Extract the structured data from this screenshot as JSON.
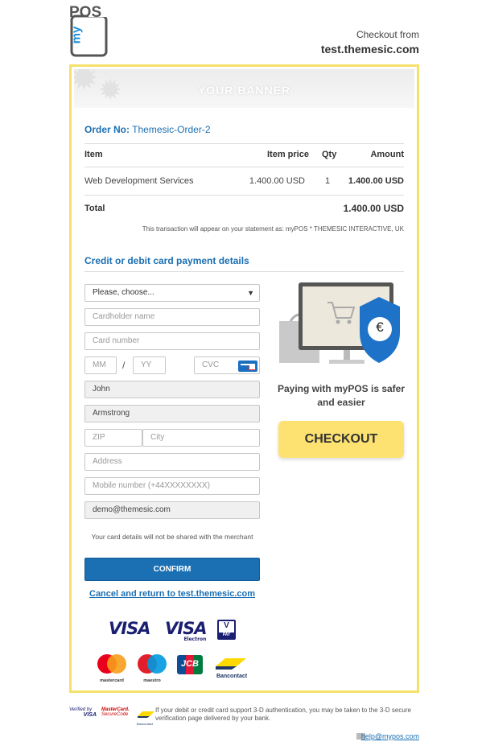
{
  "header": {
    "logo_text_top": "POS",
    "logo_text_side": "my",
    "checkout_from": "Checkout from",
    "checkout_host": "test.themesic.com"
  },
  "banner": {
    "text": "YOUR BANNER"
  },
  "order": {
    "label": "Order No:",
    "number": "Themesic-Order-2"
  },
  "table": {
    "headers": {
      "item": "Item",
      "price": "Item price",
      "qty": "Qty",
      "amount": "Amount"
    },
    "rows": [
      {
        "item": "Web Development Services",
        "price": "1.400.00 USD",
        "qty": "1",
        "amount": "1.400.00 USD"
      }
    ],
    "total_label": "Total",
    "total_value": "1.400.00 USD"
  },
  "statement": "This transaction will appear on your statement as: myPOS  * THEMESIC INTERACTIVE, UK",
  "form": {
    "title": "Credit or debit card payment details",
    "select_value": "Please, choose...",
    "cardholder_placeholder": "Cardholder name",
    "card_number_placeholder": "Card number",
    "mm_placeholder": "MM",
    "separator": "/",
    "yy_placeholder": "YY",
    "cvc_placeholder": "CVC",
    "first_name": "John",
    "last_name": "Armstrong",
    "zip_placeholder": "ZIP",
    "city_placeholder": "City",
    "address_placeholder": "Address",
    "mobile_placeholder": "Mobile number (+44XXXXXXXX)",
    "email": "demo@themesic.com",
    "note": "Your card details will not be shared with the merchant",
    "confirm_label": "CONFIRM",
    "cancel_label": "Cancel and return to test.themesic.com"
  },
  "brands": {
    "visa": "VISA",
    "visa_electron": "VISA",
    "electron_sub": "Electron",
    "vpay_v": "V",
    "vpay_pay": "PAY",
    "mastercard": "mastercard",
    "maestro": "maestro",
    "jcb": "JCB",
    "bancontact": "Bancontact"
  },
  "promo": {
    "paying_text": "Paying with myPOS is safer and easier",
    "euro_symbol": "€",
    "checkout_label": "CHECKOUT"
  },
  "footer": {
    "verified_by": "Verified by",
    "verified_visa": "VISA",
    "mc_secure_1": "MasterCard.",
    "mc_secure_2": "SecureCode",
    "bancontact_small": "Bancontact",
    "info": "If your debit or credit card support 3-D authentication, you may be taken to the 3-D secure verification page delivered by your bank.",
    "help_email": "help@mypos.com"
  },
  "colors": {
    "accent": "#1b6fb3",
    "border_yellow": "#f6e06c",
    "checkout_yellow": "#fde171"
  }
}
